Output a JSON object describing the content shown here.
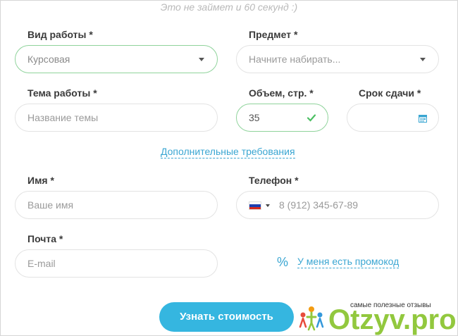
{
  "subtitle": "Это не займет и 60 секунд :)",
  "work_type": {
    "label": "Вид работы *",
    "value": "Курсовая"
  },
  "subject": {
    "label": "Предмет *",
    "placeholder": "Начните набирать..."
  },
  "topic": {
    "label": "Тема работы *",
    "placeholder": "Название темы"
  },
  "volume": {
    "label": "Объем, стр. *",
    "value": "35"
  },
  "deadline": {
    "label": "Срок сдачи *"
  },
  "extra_link": "Дополнительные требования",
  "name": {
    "label": "Имя *",
    "placeholder": "Ваше имя"
  },
  "phone": {
    "label": "Телефон *",
    "placeholder": "8 (912) 345-67-89",
    "country": "RU"
  },
  "email": {
    "label": "Почта *",
    "placeholder": "E-mail"
  },
  "promo_link": "У меня есть промокод",
  "promo_icon": "%",
  "submit": "Узнать стоимость",
  "watermark": {
    "tagline": "самые полезные отзывы",
    "brand": "Otzyv.pro"
  },
  "colors": {
    "accent": "#35b6e0",
    "valid": "#8fd39b",
    "link": "#3aa6d2",
    "brand": "#92c83e"
  }
}
